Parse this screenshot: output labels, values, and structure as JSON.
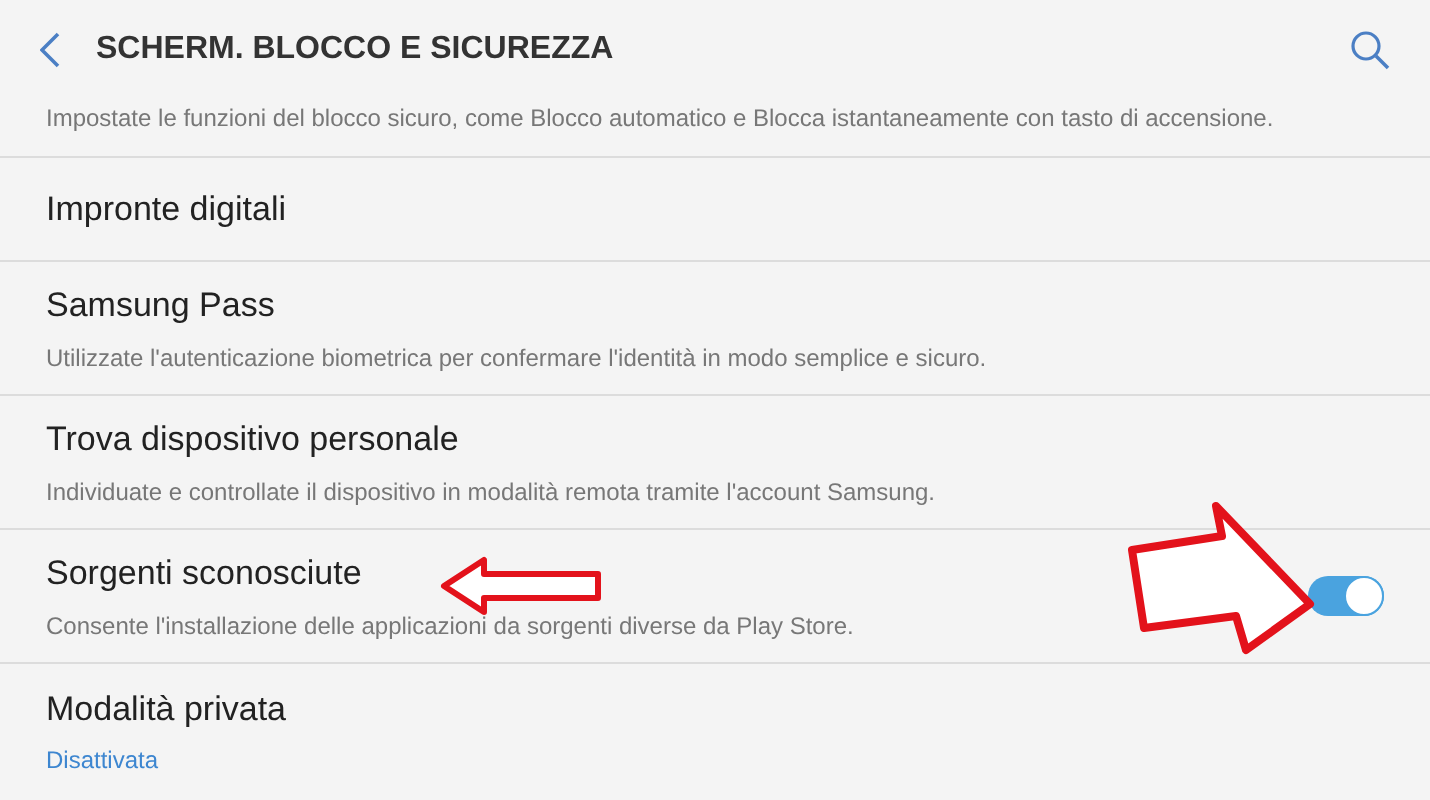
{
  "header": {
    "title": "SCHERM. BLOCCO E SICUREZZA"
  },
  "intro": "Impostate le funzioni del blocco sicuro, come Blocco automatico e Blocca istantaneamente con tasto di accensione.",
  "items": [
    {
      "title": "Impronte digitali"
    },
    {
      "title": "Samsung Pass",
      "subtitle": "Utilizzate l'autenticazione biometrica per confermare l'identità in modo semplice e sicuro."
    },
    {
      "title": "Trova dispositivo personale",
      "subtitle": "Individuate e controllate il dispositivo in modalità remota tramite l'account Samsung."
    },
    {
      "title": "Sorgenti sconosciute",
      "subtitle": "Consente l'installazione delle applicazioni da sorgenti diverse da Play Store.",
      "toggle": {
        "on": true
      }
    },
    {
      "title": "Modalità privata",
      "status": "Disattivata"
    }
  ]
}
